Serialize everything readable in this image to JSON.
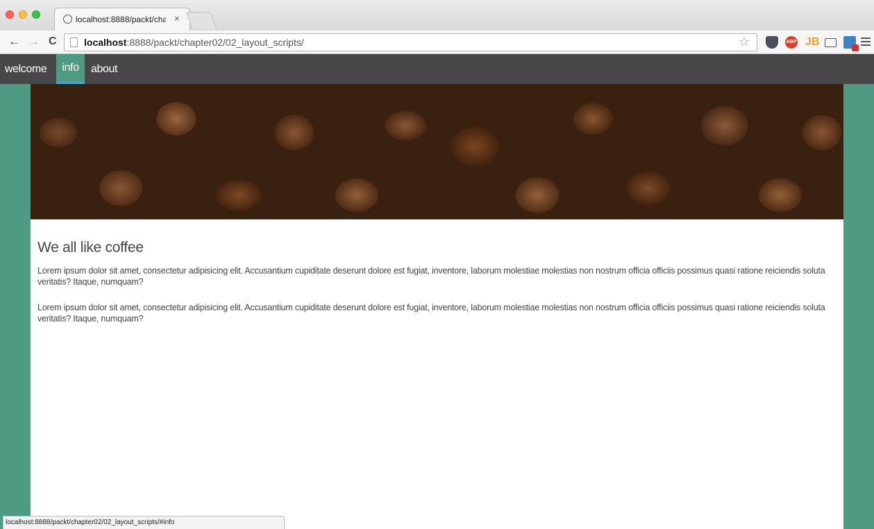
{
  "browser": {
    "tab_title": "localhost:8888/packt/chap",
    "tab_close": "×",
    "url_host": "localhost",
    "url_rest": ":8888/packt/chapter02/02_layout_scripts/",
    "nav_back": "←",
    "nav_forward": "→",
    "nav_reload": "C",
    "star": "☆",
    "extensions": {
      "abp": "ABP",
      "jb": "JB"
    },
    "status_url": "localhost:8888/packt/chapter02/02_layout_scripts/#info"
  },
  "site": {
    "nav": [
      "welcome",
      "info",
      "about"
    ],
    "active_nav": "info",
    "heading": "We all like coffee",
    "paragraphs": [
      "Lorem ipsum dolor sit amet, consectetur adipisicing elit. Accusantium cupiditate deserunt dolore est fugiat, inventore, laborum molestiae molestias non nostrum officia officiis possimus quasi ratione reiciendis soluta veritatis? Itaque, numquam?",
      "Lorem ipsum dolor sit amet, consectetur adipisicing elit. Accusantium cupiditate deserunt dolore est fugiat, inventore, laborum molestiae molestias non nostrum officia officiis possimus quasi ratione reiciendis soluta veritatis? Itaque, numquam?"
    ]
  },
  "colors": {
    "nav_bg": "#474747",
    "accent_green": "#4f9a82",
    "active_underline": "#4aa3c8"
  }
}
